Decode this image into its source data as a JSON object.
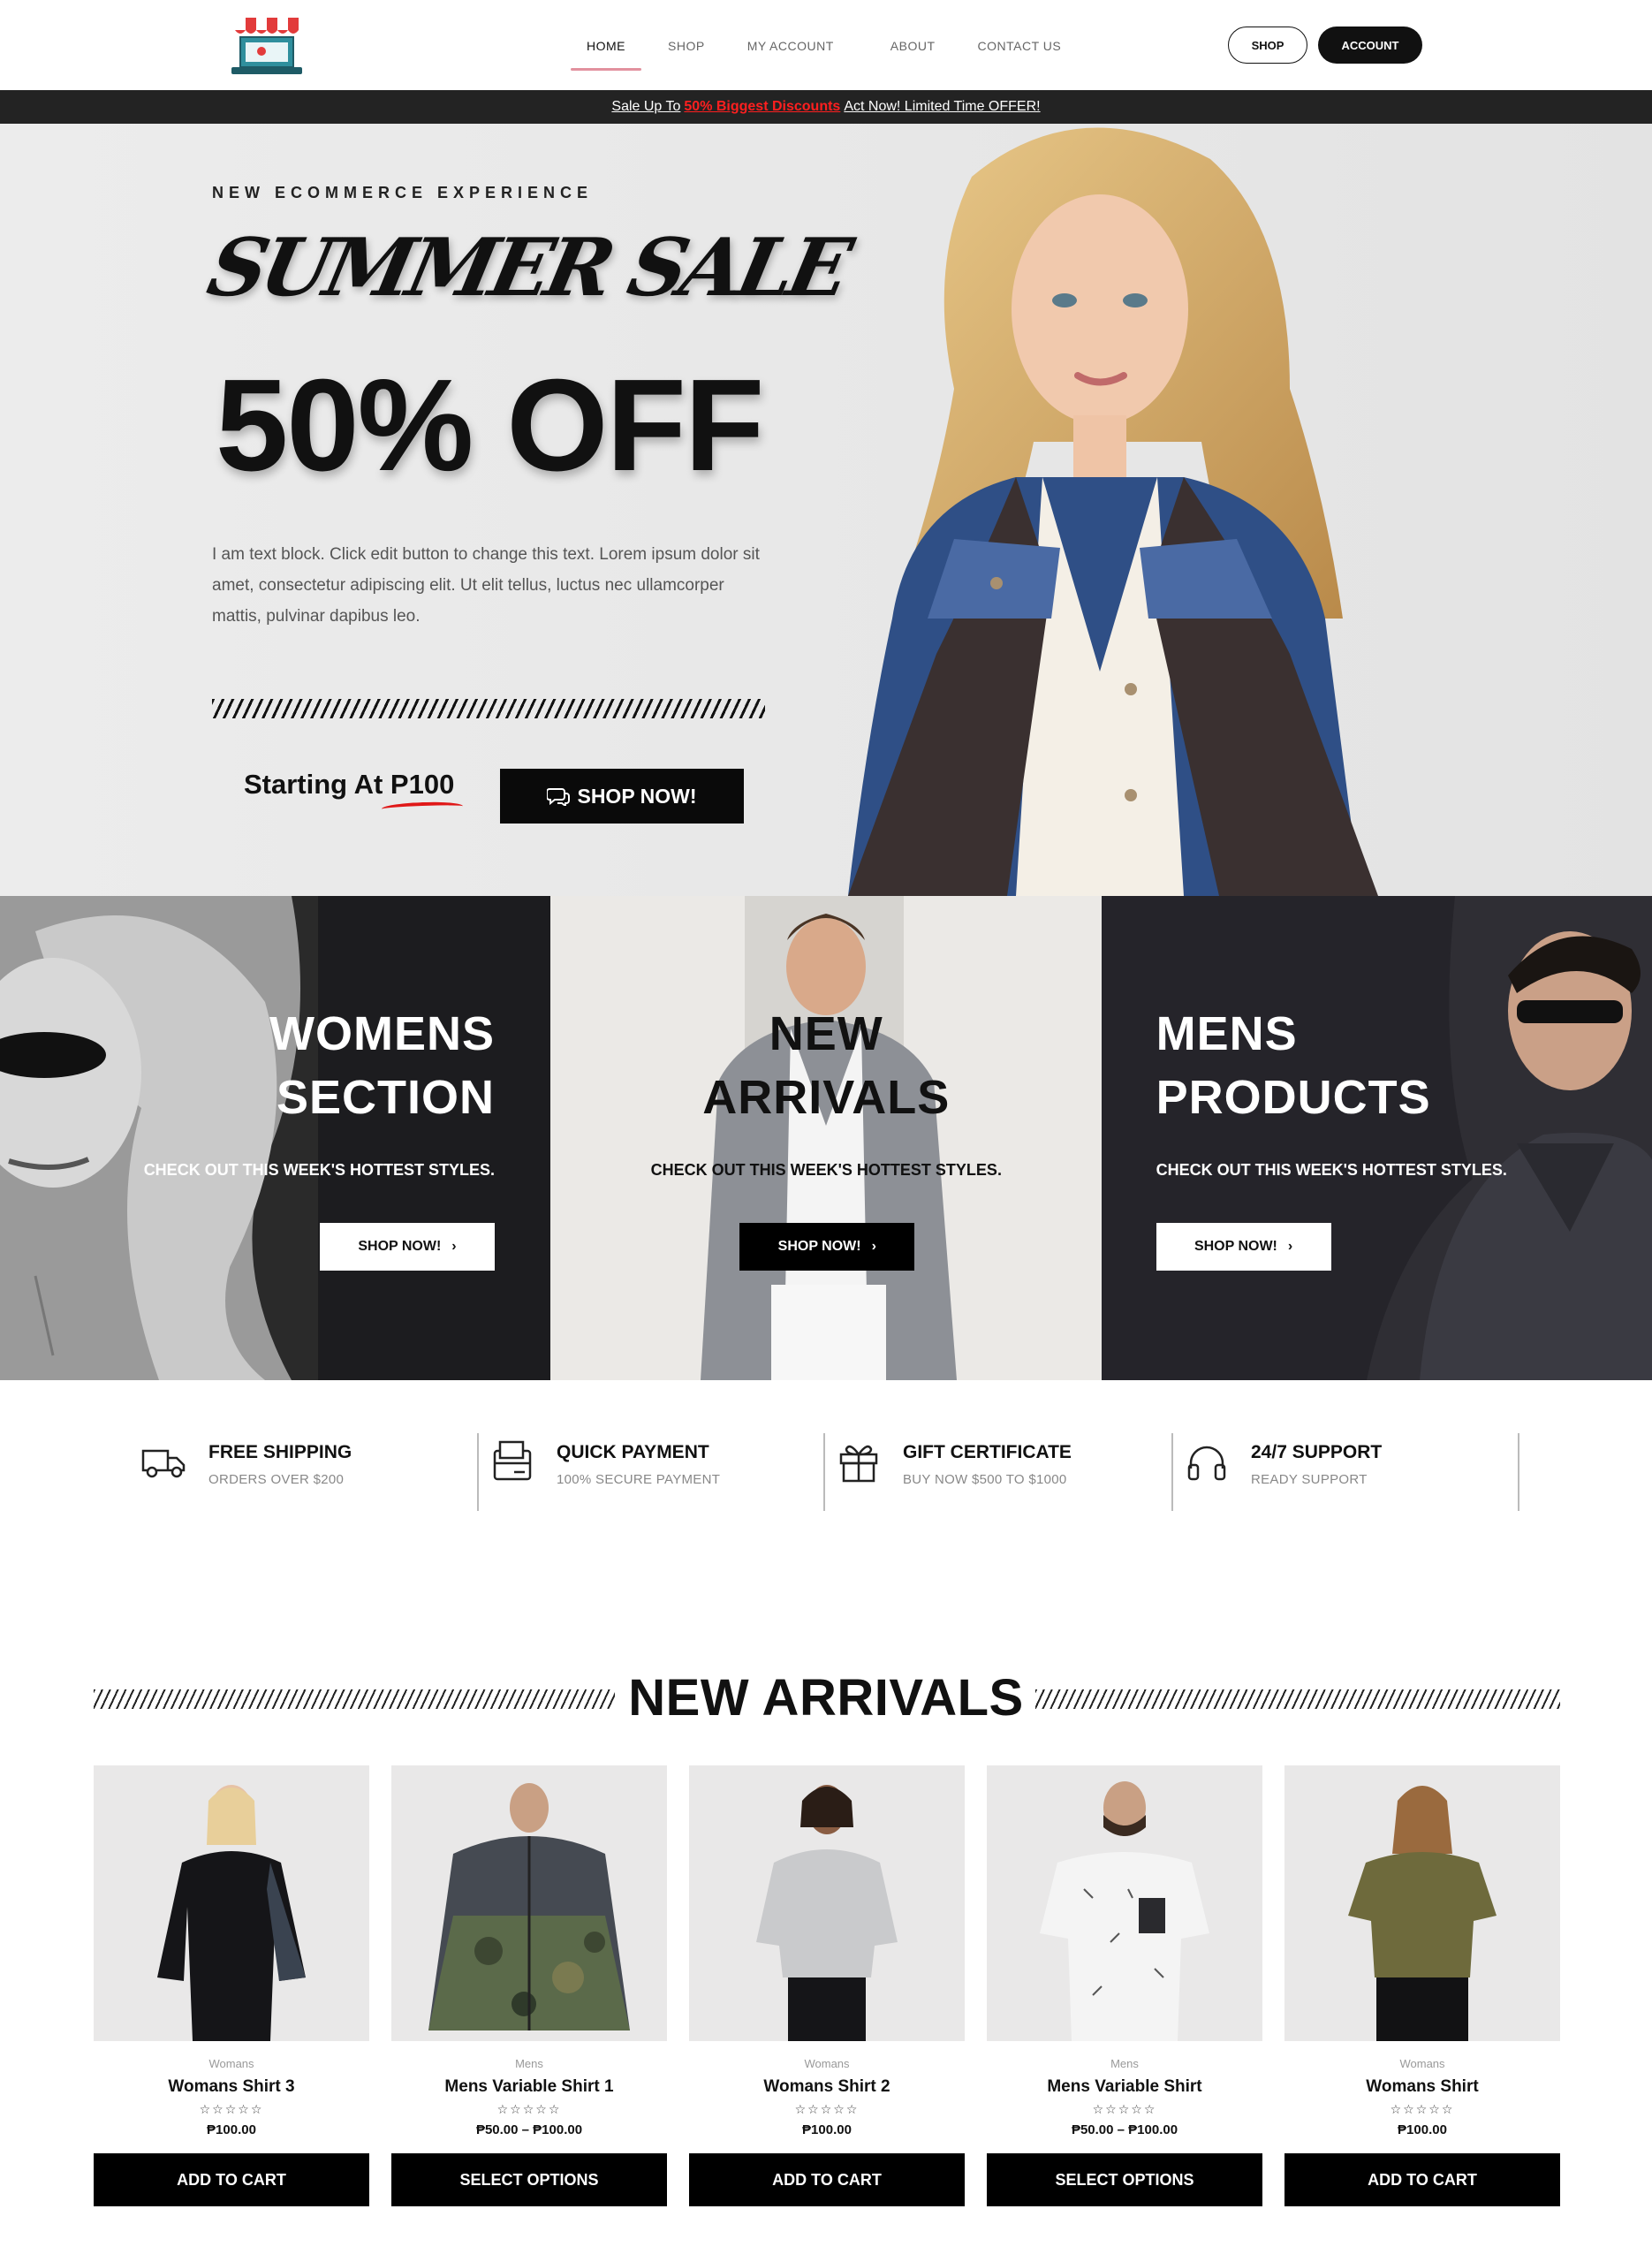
{
  "header": {
    "logo_alt": "store-logo",
    "nav": [
      {
        "label": "HOME",
        "active": true
      },
      {
        "label": "SHOP",
        "active": false
      },
      {
        "label": "MY ACCOUNT",
        "active": false
      },
      {
        "label": "ABOUT",
        "active": false
      },
      {
        "label": "CONTACT US",
        "active": false
      }
    ],
    "shop_button": "SHOP",
    "account_button": "ACCOUNT"
  },
  "promo": {
    "pre": "Sale Up To",
    "highlight": "50% Biggest Discounts",
    "post": "Act Now! Limited Time OFFER!"
  },
  "hero": {
    "eyebrow": "NEW ECOMMERCE EXPERIENCE",
    "script_title": "SUMMER SALE",
    "big_text": "50% OFF",
    "body": "I am text block. Click edit button to change this text. Lorem ipsum dolor sit amet, consectetur adipiscing elit. Ut elit tellus, luctus nec ullamcorper mattis, pulvinar dapibus leo.",
    "starting_label": "Starting At",
    "starting_price": "P100",
    "cta": "SHOP NOW!"
  },
  "tiles": [
    {
      "title_line1": "WOMENS",
      "title_line2": "SECTION",
      "subtitle": "CHECK OUT THIS WEEK'S HOTTEST STYLES.",
      "button": "SHOP NOW!"
    },
    {
      "title_line1": "NEW",
      "title_line2": "ARRIVALS",
      "subtitle": "CHECK OUT THIS WEEK'S HOTTEST STYLES.",
      "button": "SHOP NOW!"
    },
    {
      "title_line1": "MENS",
      "title_line2": "PRODUCTS",
      "subtitle": "CHECK OUT THIS WEEK'S HOTTEST STYLES.",
      "button": "SHOP NOW!"
    }
  ],
  "features": [
    {
      "icon": "truck-icon",
      "title": "FREE SHIPPING",
      "subtitle": "ORDERS OVER $200"
    },
    {
      "icon": "payment-icon",
      "title": "QUICK PAYMENT",
      "subtitle": "100% SECURE PAYMENT"
    },
    {
      "icon": "gift-icon",
      "title": "GIFT CERTIFICATE",
      "subtitle": "BUY NOW $500 TO $1000"
    },
    {
      "icon": "headphones-icon",
      "title": "24/7 SUPPORT",
      "subtitle": "READY SUPPORT"
    }
  ],
  "new_arrivals": {
    "title": "NEW ARRIVALS",
    "products": [
      {
        "category": "Womans",
        "name": "Womans Shirt 3",
        "stars": "☆☆☆☆☆",
        "price": "₱100.00",
        "button": "ADD TO CART"
      },
      {
        "category": "Mens",
        "name": "Mens Variable Shirt 1",
        "stars": "☆☆☆☆☆",
        "price": "₱50.00 – ₱100.00",
        "button": "SELECT OPTIONS"
      },
      {
        "category": "Womans",
        "name": "Womans Shirt 2",
        "stars": "☆☆☆☆☆",
        "price": "₱100.00",
        "button": "ADD TO CART"
      },
      {
        "category": "Mens",
        "name": "Mens Variable Shirt",
        "stars": "☆☆☆☆☆",
        "price": "₱50.00 – ₱100.00",
        "button": "SELECT OPTIONS"
      },
      {
        "category": "Womans",
        "name": "Womans Shirt",
        "stars": "☆☆☆☆☆",
        "price": "₱100.00",
        "button": "ADD TO CART"
      }
    ]
  }
}
